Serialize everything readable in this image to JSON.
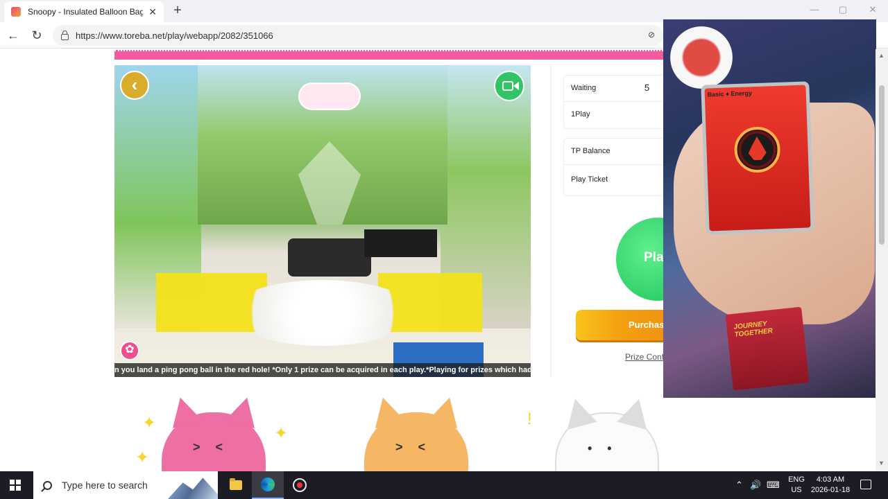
{
  "browser": {
    "tab_title": "Snoopy - Insulated Balloon Bag S",
    "new_tab_icon": "+",
    "url": "https://www.toreba.net/play/webapp/2082/351066",
    "window_controls": {
      "minimize": "—",
      "maximize": "▢",
      "close": "✕"
    }
  },
  "game": {
    "ticker_text": "n you land a ping pong ball in the red hole! *Only 1 prize can be acquired in each play.*Playing for prizes which had alrea",
    "back_icon": "‹",
    "settings_icon": "✿"
  },
  "panel": {
    "waiting_label": "Waiting",
    "waiting_count": "5",
    "oneplay_label": "1Play",
    "tp_balance_label": "TP Balance",
    "play_ticket_label": "Play Ticket",
    "play_button": "Pla",
    "purchase_button": "Purchas",
    "prize_link": "Prize Confi"
  },
  "overlay": {
    "card_title": "Basic ♦ Energy",
    "pack_label": "JOURNEY TOGETHER"
  },
  "taskbar": {
    "search_placeholder": "Type here to search",
    "tray_chevron": "⌃",
    "lang_top": "ENG",
    "lang_bottom": "US",
    "time": "4:03 AM",
    "date": "2026-01-18"
  },
  "colors": {
    "brand_pink": "#f35ba0",
    "play_green": "#1ec25a",
    "purchase_orange": "#f4a012",
    "taskbar": "#1c1c24"
  }
}
